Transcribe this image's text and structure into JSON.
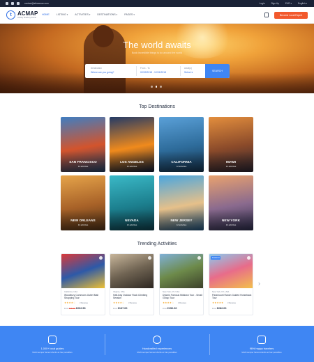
{
  "topbar": {
    "email": "contact@atheeman.com",
    "links": [
      "Login",
      "Sign Up",
      "EUR ▾",
      "English ▾"
    ]
  },
  "header": {
    "brand": "ACMAP",
    "tagline": "Activity directory theme",
    "nav": [
      {
        "label": "HOME",
        "active": true,
        "dropdown": false
      },
      {
        "label": "LISTING",
        "active": false,
        "dropdown": true
      },
      {
        "label": "ACTIVITIES",
        "active": false,
        "dropdown": true
      },
      {
        "label": "DESTINATIONS",
        "active": false,
        "dropdown": true
      },
      {
        "label": "PAGES",
        "active": false,
        "dropdown": true
      }
    ],
    "cta_label": "Become Local Expert"
  },
  "hero": {
    "title": "The world awaits",
    "subtitle": "Book incredible things to do around the world",
    "search": {
      "destination_label": "Destination",
      "destination_placeholder": "Where are you going?",
      "dates_label": "From - To",
      "dates_value": "02/02/2018 - 12/01/2018",
      "adults_label": "Adult(s)",
      "adults_value": "Select ▾",
      "button": "SEARCH"
    },
    "slides": 3,
    "active_slide": 1
  },
  "destinations": {
    "title": "Top Destinations",
    "items": [
      {
        "name": "SAN FRANCISCO",
        "count": "12 activities",
        "colors": [
          "#3f7ec2",
          "#d3542c",
          "#1f3f64"
        ]
      },
      {
        "name": "LOS ANGELES",
        "count": "12 activities",
        "colors": [
          "#233a66",
          "#f08a1c",
          "#0d1a33"
        ]
      },
      {
        "name": "CALIFORNIA",
        "count": "12 activities",
        "colors": [
          "#5aa0d8",
          "#2e6c9b",
          "#15324c"
        ]
      },
      {
        "name": "MIAMI",
        "count": "12 activities",
        "colors": [
          "#e38e3d",
          "#8a4a2a",
          "#2a2430"
        ]
      },
      {
        "name": "NEW ORLEANS",
        "count": "12 activities",
        "colors": [
          "#e6a44a",
          "#a86228",
          "#4e3016"
        ]
      },
      {
        "name": "NEVADA",
        "count": "12 activities",
        "colors": [
          "#3bb9c7",
          "#1c7f8e",
          "#0e3e4a"
        ]
      },
      {
        "name": "NEW JERSEY",
        "count": "12 activities",
        "colors": [
          "#4aa6df",
          "#e6c08a",
          "#1e4f77"
        ]
      },
      {
        "name": "NEW YORK",
        "count": "12 activities",
        "colors": [
          "#e9a26f",
          "#8a6a8e",
          "#2b2c4a"
        ]
      }
    ]
  },
  "activities": {
    "title": "Trending Activities",
    "items": [
      {
        "location": "California, USA",
        "title": "Woodbury Commons Outlet Mall Shopping Tour",
        "stars": "★★★★☆",
        "reviews": "3 Reviews",
        "from": "From",
        "old_price": "€282.50",
        "price": "€202.50",
        "badge": "",
        "colors": [
          "#d9393a",
          "#2d59a8",
          "#f2c230"
        ]
      },
      {
        "location": "Virginia, USA",
        "title": "Half-Day Outdoor Rock Climbing Session",
        "stars": "★★★★☆",
        "reviews": "3 Reviews",
        "from": "From",
        "old_price": "",
        "price": "€137.00",
        "badge": "",
        "colors": [
          "#c7b59a",
          "#6f6352",
          "#2b2520"
        ]
      },
      {
        "location": "New York, NY, USA",
        "title": "Dylan's Famous Midtown Tour - Small Group Tour",
        "stars": "★★★★☆",
        "reviews": "3 Reviews",
        "from": "From",
        "old_price": "",
        "price": "€152.00",
        "badge": "",
        "colors": [
          "#7fb0d6",
          "#6d8a4a",
          "#3b3f2a"
        ]
      },
      {
        "location": "New York, NY, USA",
        "title": "Paramount Ranch Guided Horseback Tour",
        "stars": "★★★★★",
        "reviews": "3 Reviews",
        "from": "From",
        "old_price": "",
        "price": "€282.00",
        "badge": "Featured",
        "colors": [
          "#8cc9ee",
          "#e86c8a",
          "#f3c14a"
        ]
      }
    ]
  },
  "features": [
    {
      "title": "1,000+ local guides",
      "desc": "Morbi semper fames lobortis ac hac penatibus"
    },
    {
      "title": "Handcrafted experiences",
      "desc": "Morbi semper fames lobortis ac hac penatibus"
    },
    {
      "title": "96% happy travelers",
      "desc": "Morbi semper fames lobortis ac hac penatibus"
    }
  ]
}
